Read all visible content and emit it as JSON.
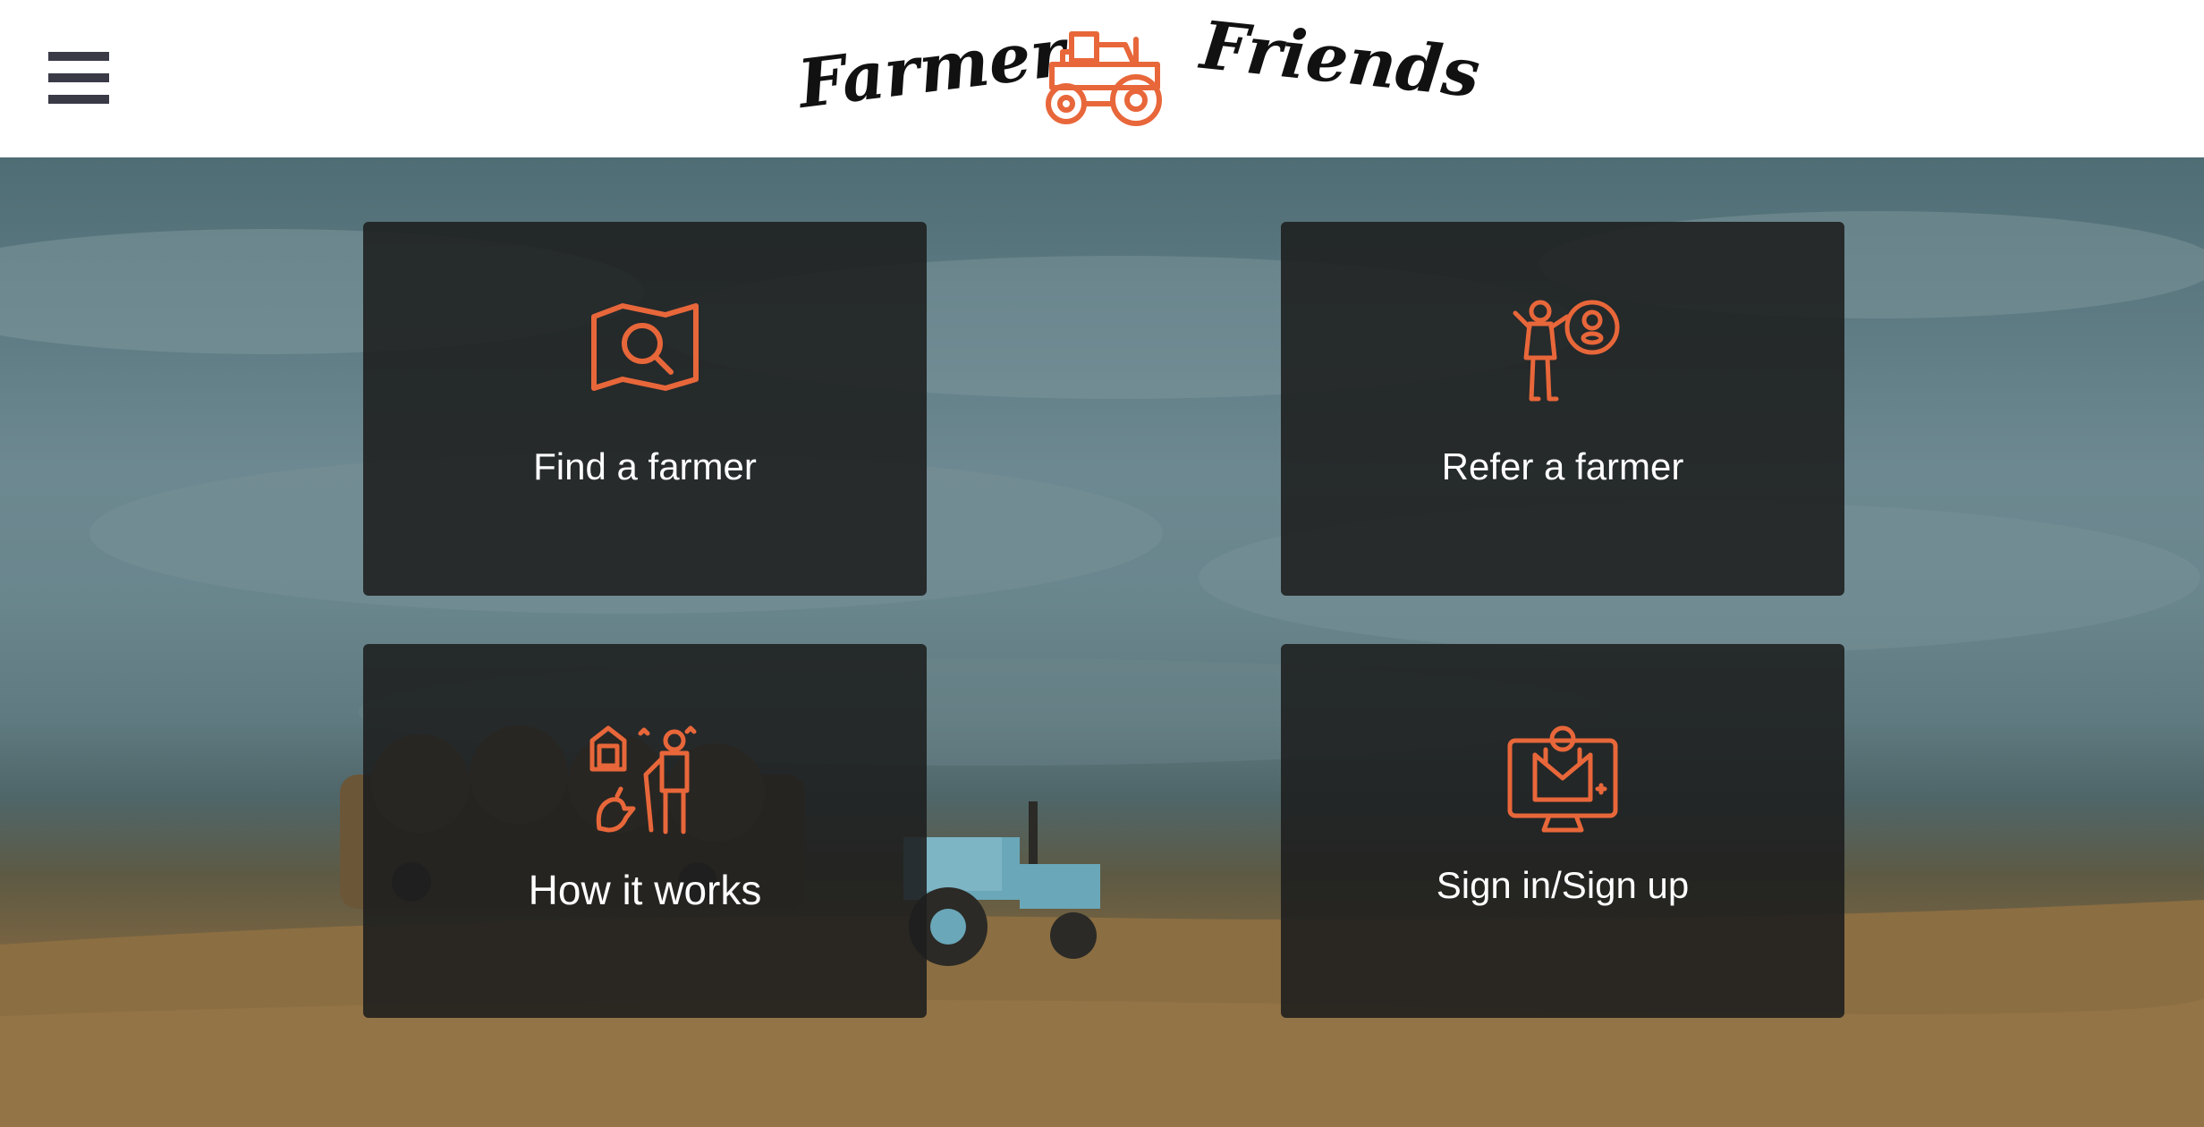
{
  "header": {
    "brand_left": "Farmer",
    "brand_right": "Friends",
    "menu_icon": "hamburger-menu-icon",
    "logo_icon": "tractor-icon"
  },
  "colors": {
    "accent": "#e8673a",
    "card_bg": "#1c1e1e",
    "header_bg": "#ffffff",
    "menu_icon": "#3a3a47"
  },
  "cards": [
    {
      "label": "Find a farmer",
      "icon": "map-search-icon"
    },
    {
      "label": "Refer a farmer",
      "icon": "farmer-referral-icon"
    },
    {
      "label": "How it works",
      "icon": "farm-life-icon"
    },
    {
      "label": "Sign in/Sign up",
      "icon": "user-laptop-icon"
    }
  ]
}
